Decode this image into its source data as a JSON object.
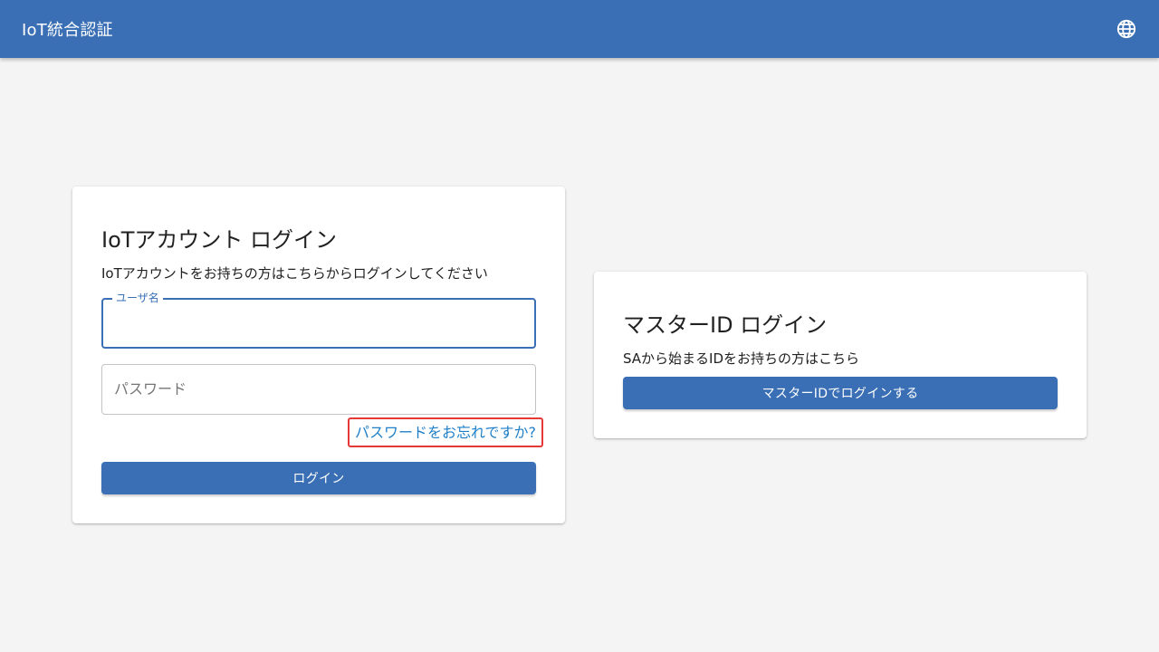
{
  "header": {
    "title": "IoT統合認証",
    "language_icon": "globe-icon"
  },
  "iot_login": {
    "title": "IoTアカウント ログイン",
    "subtitle": "IoTアカウントをお持ちの方はこちらからログインしてください",
    "username_label": "ユーザ名",
    "username_value": "",
    "password_label": "パスワード",
    "password_value": "",
    "forgot_password_link": "パスワードをお忘れですか?",
    "login_button": "ログイン"
  },
  "master_login": {
    "title": "マスターID ログイン",
    "subtitle": "SAから始まるIDをお持ちの方はこちら",
    "login_button": "マスターIDでログインする"
  },
  "colors": {
    "primary": "#3a6fb5",
    "link": "#1e7fc8",
    "highlight_border": "#e53935",
    "background": "#f4f4f4"
  }
}
